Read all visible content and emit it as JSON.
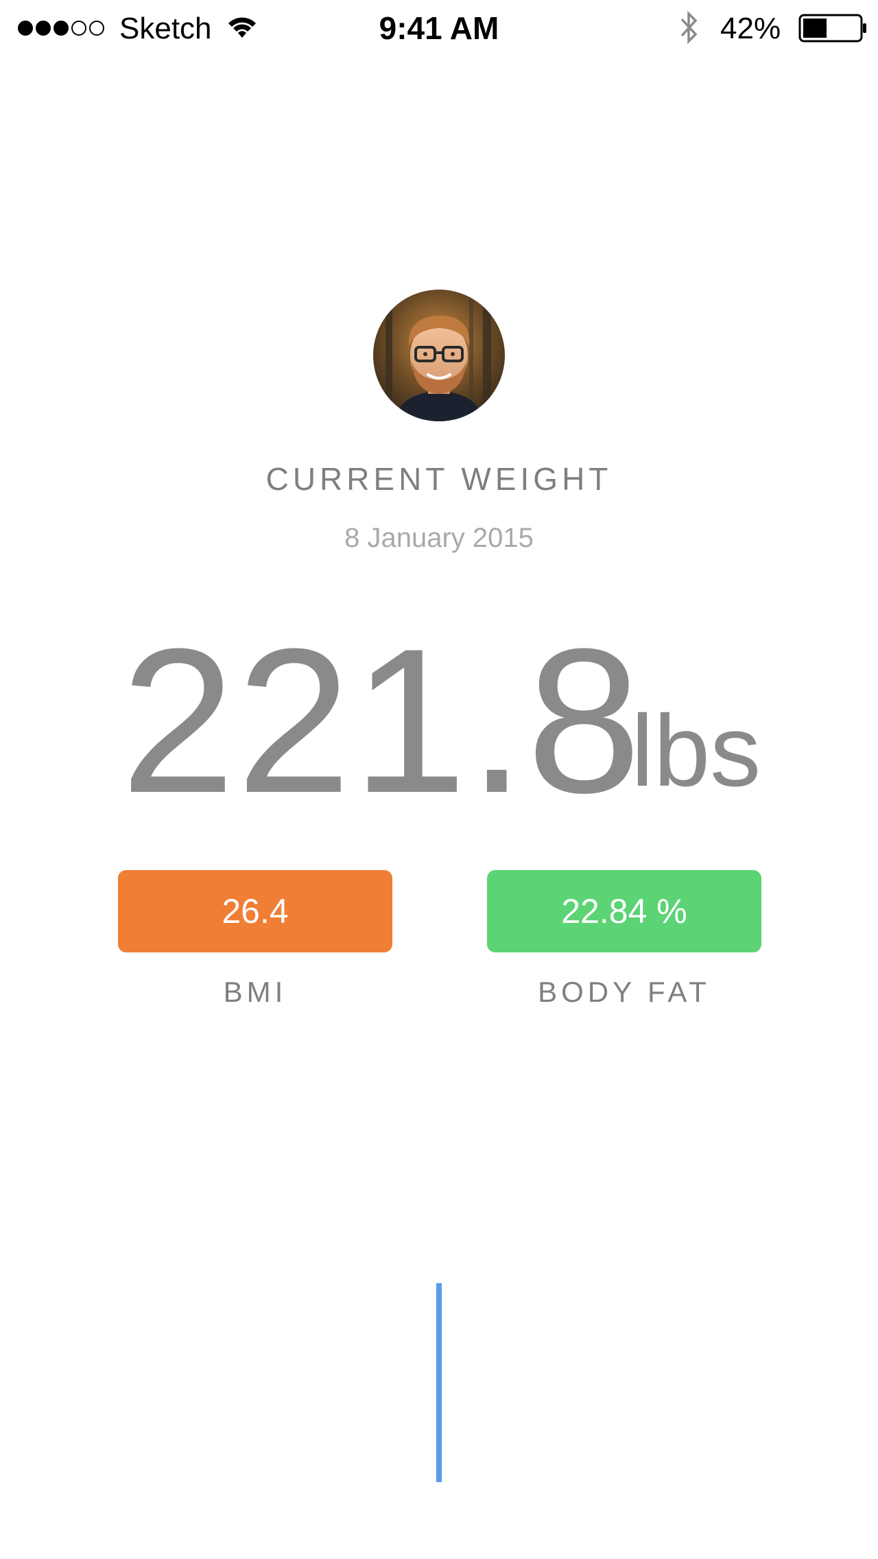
{
  "status_bar": {
    "carrier": "Sketch",
    "time": "9:41 AM",
    "battery_percent": "42%",
    "signal_bars_filled": 3,
    "signal_bars_total": 5,
    "battery_level": 0.42,
    "icons": [
      "signal-icon",
      "wifi-icon",
      "bluetooth-icon",
      "battery-icon"
    ]
  },
  "profile": {
    "avatar": "avatar-photo"
  },
  "weight": {
    "title": "CURRENT WEIGHT",
    "date": "8 January 2015",
    "value": "221.8",
    "unit": "lbs"
  },
  "stats": {
    "bmi": {
      "value": "26.4",
      "label": "BMI",
      "color": "#f07e34"
    },
    "body_fat": {
      "value": "22.84 %",
      "label": "BODY FAT",
      "color": "#5cd374"
    }
  },
  "scale": {
    "indicator_color": "#5b9be8"
  }
}
